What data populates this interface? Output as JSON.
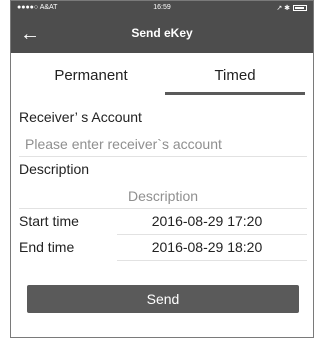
{
  "status_bar": {
    "carrier": "●●●●○ A&AT",
    "wifi_icon": "wifi-icon",
    "time": "16:59",
    "right_icons": "↗ ✱"
  },
  "nav": {
    "back_glyph": "←",
    "title": "Send eKey"
  },
  "tabs": {
    "permanent": "Permanent",
    "timed": "Timed",
    "active": "timed"
  },
  "form": {
    "receiver_label": "Receiver’ s Account",
    "receiver_placeholder": "Please enter receiver`s account",
    "receiver_value": "",
    "description_label": "Description",
    "description_placeholder": "Description",
    "description_value": "",
    "start_label": "Start time",
    "start_value": "2016-08-29 17:20",
    "end_label": "End time",
    "end_value": "2016-08-29 18:20"
  },
  "send_button": {
    "label": "Send"
  },
  "colors": {
    "bar": "#4d4d4d",
    "button": "#5a5a5a",
    "underline": "#5a5a5a",
    "placeholder": "#8f8f8f"
  }
}
